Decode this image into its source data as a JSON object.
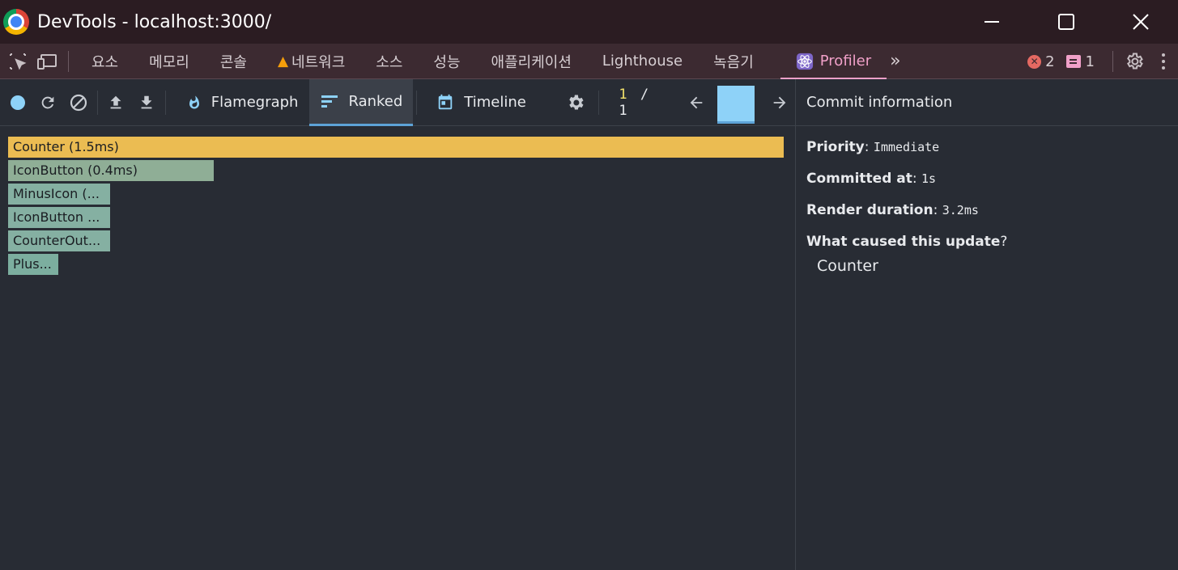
{
  "window": {
    "title": "DevTools - localhost:3000/"
  },
  "devtools_tabs": [
    {
      "label": "요소",
      "warning": false
    },
    {
      "label": "메모리",
      "warning": false
    },
    {
      "label": "콘솔",
      "warning": false
    },
    {
      "label": "네트워크",
      "warning": true
    },
    {
      "label": "소스",
      "warning": false
    },
    {
      "label": "성능",
      "warning": false
    },
    {
      "label": "애플리케이션",
      "warning": false
    },
    {
      "label": "Lighthouse",
      "warning": false
    },
    {
      "label": "녹음기",
      "warning": false
    }
  ],
  "active_tab": {
    "label": "Profiler",
    "icon": "react-icon"
  },
  "status": {
    "errors": "2",
    "messages": "1"
  },
  "toolbar": {
    "flamegraph_label": "Flamegraph",
    "ranked_label": "Ranked",
    "timeline_label": "Timeline",
    "commit_current": "1",
    "commit_separator": "/",
    "commit_total": "1"
  },
  "ranked_chart": {
    "items": [
      {
        "label": "Counter (1.5ms)",
        "duration_ms": 1.5,
        "color": "#ebbc52"
      },
      {
        "label": "IconButton (0.4ms)",
        "duration_ms": 0.4,
        "color": "#8fae96"
      },
      {
        "label": "MinusIcon (...",
        "color": "#85b0a2"
      },
      {
        "label": "IconButton ...",
        "color": "#85b0a2"
      },
      {
        "label": "CounterOut...",
        "color": "#85b0a2"
      },
      {
        "label": "Plus...",
        "color": "#7cae9f"
      }
    ]
  },
  "commit_info": {
    "header": "Commit information",
    "priority_label": "Priority",
    "priority_value": "Immediate",
    "committed_label": "Committed at",
    "committed_value": "1s",
    "render_label": "Render duration",
    "render_value": "3.2ms",
    "cause_label": "What caused this update",
    "cause_punct": "?",
    "cause_items": [
      "Counter"
    ]
  },
  "colors": {
    "background": "#282c34",
    "title_bar": "#2b1c22",
    "tab_strip": "#3c2a31",
    "active_tab_accent": "#f0a0c8",
    "commit_bar": "#8ed2f8",
    "selected_underline": "#5da3d8"
  }
}
